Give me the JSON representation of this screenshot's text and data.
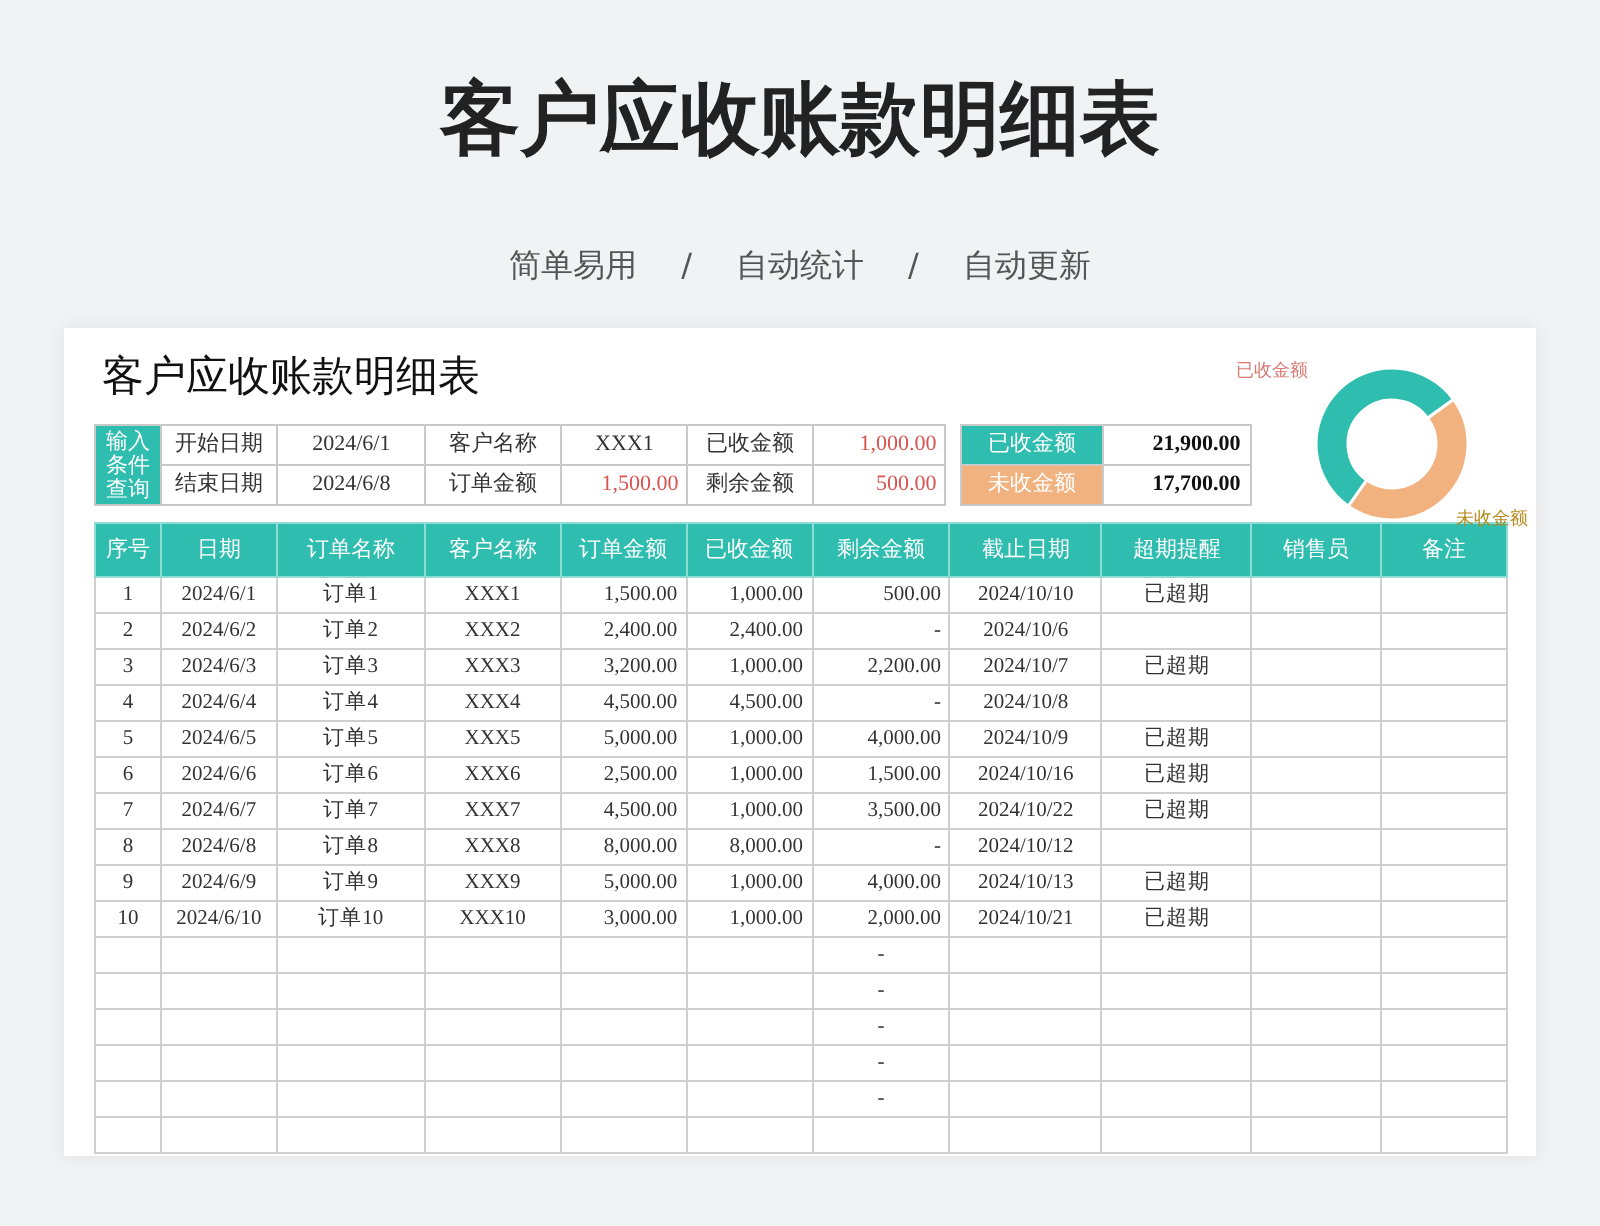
{
  "title": "客户应收账款明细表",
  "subtitle": [
    "简单易用",
    "/",
    "自动统计",
    "/",
    "自动更新"
  ],
  "sheet": {
    "title": "客户应收账款明细表",
    "query": {
      "label": "输入条件查询",
      "rows": [
        [
          "开始日期",
          "2024/6/1",
          "客户名称",
          "XXX1",
          "已收金额",
          "1,000.00"
        ],
        [
          "结束日期",
          "2024/6/8",
          "订单金额",
          "1,500.00",
          "剩余金额",
          "500.00"
        ]
      ]
    },
    "summary": [
      {
        "label": "已收金额",
        "value": "21,900.00",
        "color": "#2ebdaf"
      },
      {
        "label": "未收金额",
        "value": "17,700.00",
        "color": "#f2b27f"
      }
    ],
    "chart_data": {
      "type": "donut",
      "categories": [
        "已收金额",
        "未收金额"
      ],
      "values": [
        55.3,
        44.7
      ],
      "colors": [
        "#2ebdaf",
        "#f2b27f"
      ]
    },
    "table": {
      "columns": [
        "序号",
        "日期",
        "订单名称",
        "客户名称",
        "订单金额",
        "已收金额",
        "剩余金额",
        "截止日期",
        "超期提醒",
        "销售员",
        "备注"
      ],
      "rows": [
        {
          "no": "1",
          "date": "2024/6/1",
          "order": "订单1",
          "customer": "XXX1",
          "amount": "1,500.00",
          "received": "1,000.00",
          "remaining": "500.00",
          "due": "2024/10/10",
          "overdue": "已超期"
        },
        {
          "no": "2",
          "date": "2024/6/2",
          "order": "订单2",
          "customer": "XXX2",
          "amount": "2,400.00",
          "received": "2,400.00",
          "remaining": "-",
          "due": "2024/10/6"
        },
        {
          "no": "3",
          "date": "2024/6/3",
          "order": "订单3",
          "customer": "XXX3",
          "amount": "3,200.00",
          "received": "1,000.00",
          "remaining": "2,200.00",
          "due": "2024/10/7",
          "overdue": "已超期"
        },
        {
          "no": "4",
          "date": "2024/6/4",
          "order": "订单4",
          "customer": "XXX4",
          "amount": "4,500.00",
          "received": "4,500.00",
          "remaining": "-",
          "due": "2024/10/8"
        },
        {
          "no": "5",
          "date": "2024/6/5",
          "order": "订单5",
          "customer": "XXX5",
          "amount": "5,000.00",
          "received": "1,000.00",
          "remaining": "4,000.00",
          "due": "2024/10/9",
          "overdue": "已超期"
        },
        {
          "no": "6",
          "date": "2024/6/6",
          "order": "订单6",
          "customer": "XXX6",
          "amount": "2,500.00",
          "received": "1,000.00",
          "remaining": "1,500.00",
          "due": "2024/10/16",
          "overdue": "已超期"
        },
        {
          "no": "7",
          "date": "2024/6/7",
          "order": "订单7",
          "customer": "XXX7",
          "amount": "4,500.00",
          "received": "1,000.00",
          "remaining": "3,500.00",
          "due": "2024/10/22",
          "overdue": "已超期"
        },
        {
          "no": "8",
          "date": "2024/6/8",
          "order": "订单8",
          "customer": "XXX8",
          "amount": "8,000.00",
          "received": "8,000.00",
          "remaining": "-",
          "due": "2024/10/12"
        },
        {
          "no": "9",
          "date": "2024/6/9",
          "order": "订单9",
          "customer": "XXX9",
          "amount": "5,000.00",
          "received": "1,000.00",
          "remaining": "4,000.00",
          "due": "2024/10/13",
          "overdue": "已超期"
        },
        {
          "no": "10",
          "date": "2024/6/10",
          "order": "订单10",
          "customer": "XXX10",
          "amount": "3,000.00",
          "received": "1,000.00",
          "remaining": "2,000.00",
          "due": "2024/10/21",
          "overdue": "已超期"
        },
        {
          "remaining": "-"
        },
        {
          "remaining": "-"
        },
        {
          "remaining": "-"
        },
        {
          "remaining": "-"
        },
        {
          "remaining": "-"
        },
        {}
      ]
    }
  }
}
